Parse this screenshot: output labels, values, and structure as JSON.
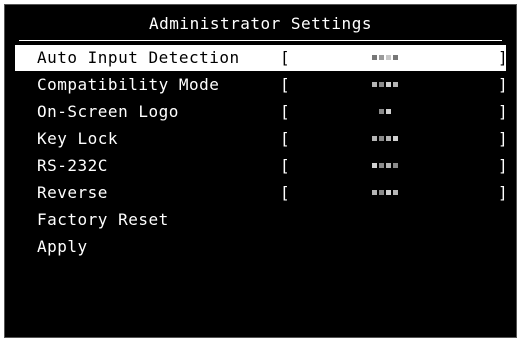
{
  "title": "Administrator Settings",
  "items": [
    {
      "label": "Auto Input Detection",
      "bracket_open": "[",
      "bracket_close": "]"
    },
    {
      "label": "Compatibility Mode",
      "bracket_open": "[",
      "bracket_close": "]"
    },
    {
      "label": "On-Screen Logo",
      "bracket_open": "[",
      "bracket_close": "]"
    },
    {
      "label": "Key Lock",
      "bracket_open": "[",
      "bracket_close": "]"
    },
    {
      "label": "RS-232C",
      "bracket_open": "[",
      "bracket_close": "]"
    },
    {
      "label": "Reverse",
      "bracket_open": "[",
      "bracket_close": "]"
    },
    {
      "label": "Factory Reset"
    },
    {
      "label": "Apply"
    }
  ],
  "selected_item": "Auto Input Detection",
  "colors": {
    "background": "#000000",
    "text": "#ffffff",
    "highlight": "#ffffff"
  }
}
